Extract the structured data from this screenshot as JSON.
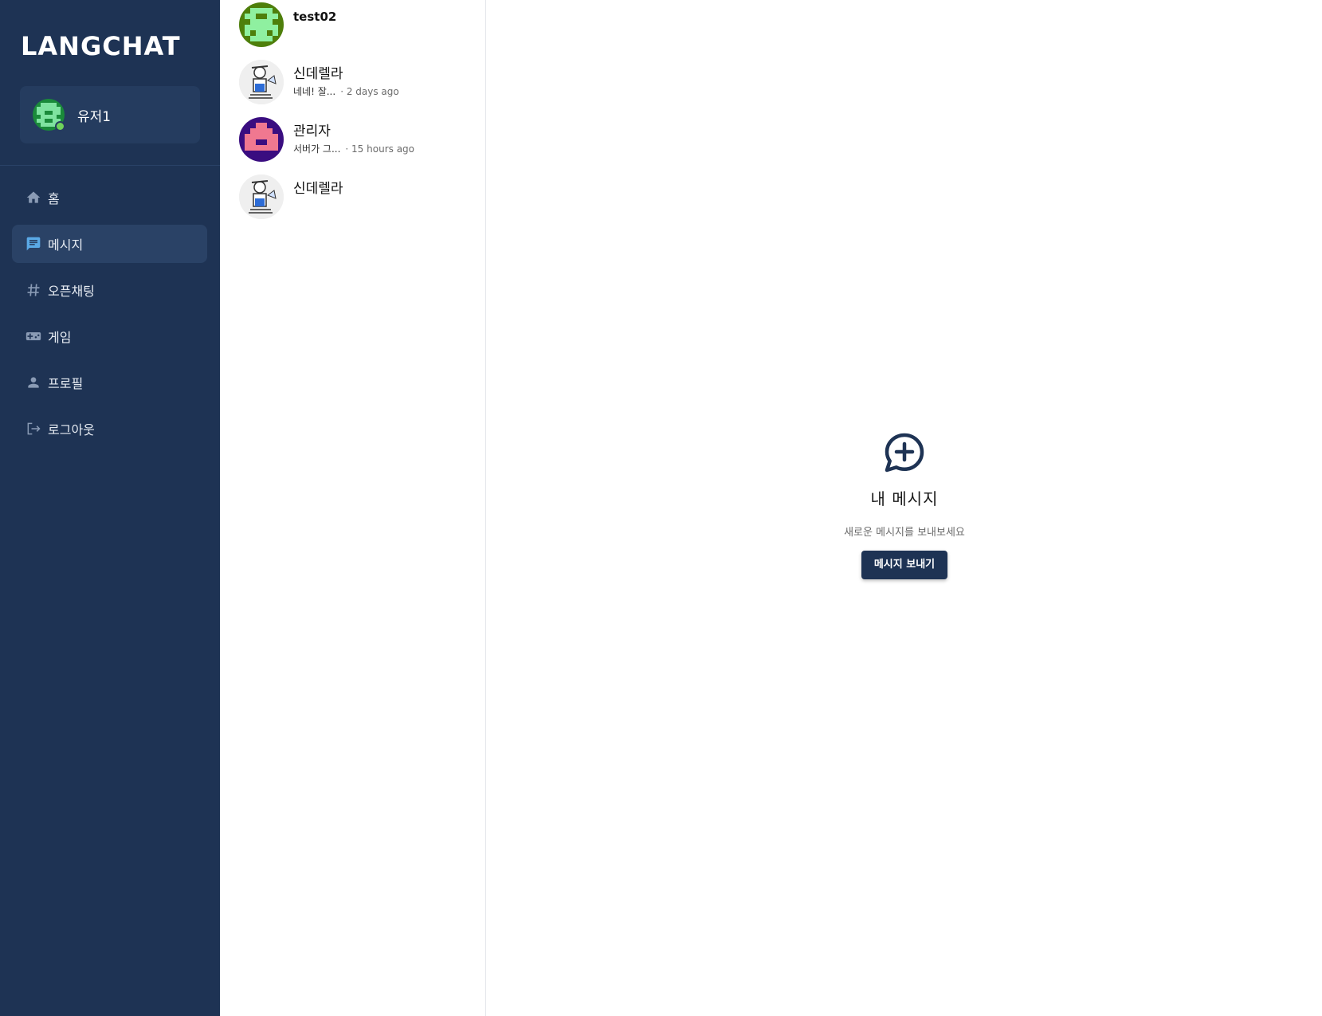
{
  "app": {
    "logo": "LANGCHAT"
  },
  "user": {
    "name": "유저1",
    "status": "online"
  },
  "sidebar": {
    "items": [
      {
        "label": "홈",
        "icon": "home-icon"
      },
      {
        "label": "메시지",
        "icon": "message-icon",
        "active": true
      },
      {
        "label": "오픈채팅",
        "icon": "hash-icon"
      },
      {
        "label": "게임",
        "icon": "gamepad-icon"
      },
      {
        "label": "프로필",
        "icon": "person-icon"
      },
      {
        "label": "로그아웃",
        "icon": "logout-icon"
      }
    ]
  },
  "chats": [
    {
      "name": "test02",
      "preview": "",
      "time": ""
    },
    {
      "name": "신데렐라",
      "preview": "네네! 잘...",
      "time": "· 2 days ago"
    },
    {
      "name": "관리자",
      "preview": "서버가 그...",
      "time": "· 15 hours ago"
    },
    {
      "name": "신데렐라",
      "preview": "",
      "time": ""
    }
  ],
  "main": {
    "title": "내 메시지",
    "subtitle": "새로운 메시지를 보내보세요",
    "button": "메시지 보내기"
  },
  "colors": {
    "sidebar_bg": "#1e3354",
    "active_item": "#2a4266",
    "accent": "#1e3354",
    "online": "#6fd35a"
  }
}
